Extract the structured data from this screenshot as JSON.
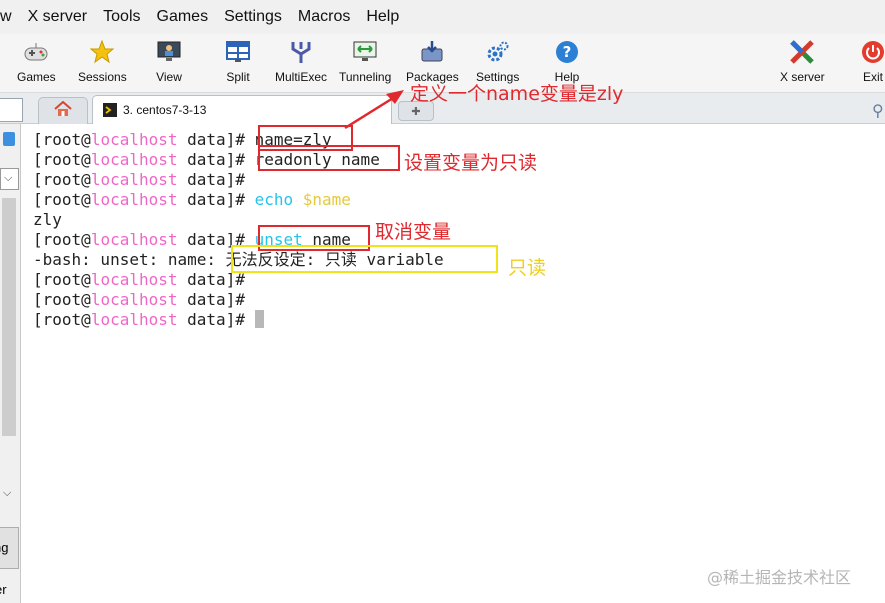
{
  "menu": [
    "w",
    "X server",
    "Tools",
    "Games",
    "Settings",
    "Macros",
    "Help"
  ],
  "toolbar": {
    "games": "Games",
    "sessions": "Sessions",
    "view": "View",
    "split": "Split",
    "multiexec": "MultiExec",
    "tunneling": "Tunneling",
    "packages": "Packages",
    "settings": "Settings",
    "help": "Help",
    "xserver": "X server",
    "exit": "Exit"
  },
  "tabs": {
    "active_label": "3. centos7-3-13"
  },
  "sidepanel": {
    "button_label": "ng",
    "bottom_label": "er"
  },
  "terminal": {
    "user": "root",
    "host": "localhost",
    "dir": "data",
    "lines": {
      "l1_cmd": "name=zly",
      "l2_cmd": "readonly name",
      "l4_cmd": "echo",
      "l4_var": "$name",
      "l5_out": "zly",
      "l6_cmd": "unset",
      "l6_arg": "name",
      "l7_prefix": "-bash: unset: name: ",
      "l7_msg": "无法反设定: 只读 variable"
    }
  },
  "annotations": {
    "define": "定义一个name变量是zly",
    "readonly": "设置变量为只读",
    "unset": "取消变量",
    "readonly_short": "只读"
  },
  "watermark": "@稀土掘金技术社区",
  "colors": {
    "prompt_host": "#f066c7",
    "command_cyan": "#27c3e9",
    "variable_yellow": "#e6c93a",
    "annotation_red": "#e0292e",
    "annotation_yellow": "#f2e21a"
  }
}
